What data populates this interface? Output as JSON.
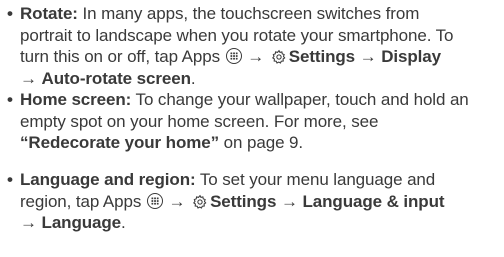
{
  "bullet_char": "•",
  "arrow": "→",
  "items": [
    {
      "label": "Rotate:",
      "line1": " In many apps, the touchscreen switches from",
      "line2": "portrait to landscape when you rotate your smartphone. To",
      "line3_pre": "turn this on or off, tap Apps ",
      "settings": "Settings",
      "display": "Display",
      "auto_rotate": "Auto-rotate screen",
      "end": "."
    },
    {
      "label": "Home screen:",
      "line1": " To change your wallpaper, touch and hold an",
      "line2": "empty spot on your home screen. For more, see",
      "quote_open": "“",
      "link": "Redecorate your home",
      "quote_close": "”",
      "page_ref": " on page 9."
    },
    {
      "label": "Language and region:",
      "line1": " To set your menu language and",
      "line2_pre": "region, tap Apps ",
      "settings": "Settings",
      "lang_input": "Language & input",
      "language": "Language",
      "end": "."
    }
  ],
  "icons": [
    "apps-icon",
    "gear-icon"
  ]
}
